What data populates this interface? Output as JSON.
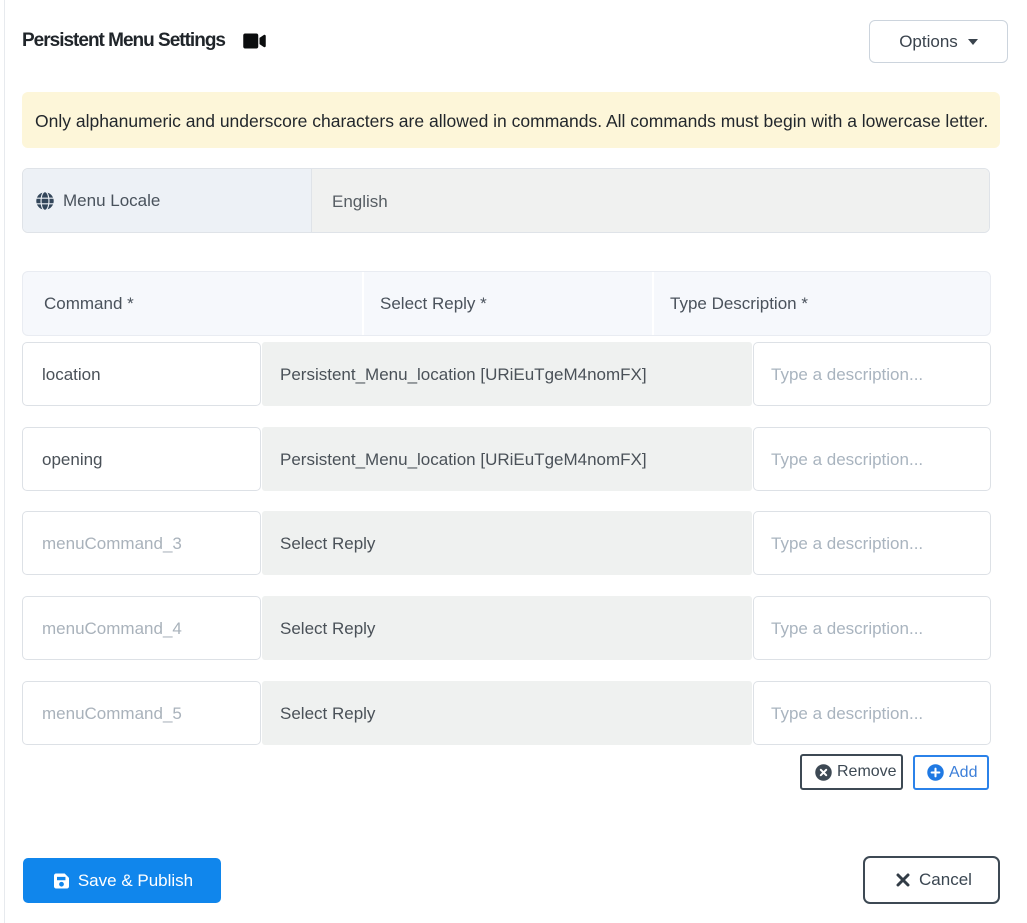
{
  "header": {
    "title": "Persistent Menu Settings",
    "options_label": "Options"
  },
  "alert": {
    "text": "Only alphanumeric and underscore characters are allowed in commands. All commands must begin with a lowercase letter."
  },
  "locale": {
    "label": "Menu Locale",
    "value": "English"
  },
  "table": {
    "headers": [
      "Command *",
      "Select Reply *",
      "Type Description *"
    ],
    "description_placeholder": "Type a description...",
    "rows": [
      {
        "command": "location",
        "reply": "Persistent_Menu_location [URiEuTgeM4nomFX]"
      },
      {
        "command": "opening",
        "reply": "Persistent_Menu_location [URiEuTgeM4nomFX]"
      },
      {
        "command": "menuCommand_3",
        "reply": "Select Reply"
      },
      {
        "command": "menuCommand_4",
        "reply": "Select Reply"
      },
      {
        "command": "menuCommand_5",
        "reply": "Select Reply"
      }
    ]
  },
  "actions": {
    "remove_label": "Remove",
    "add_label": "Add"
  },
  "footer": {
    "save_label": "Save & Publish",
    "cancel_label": "Cancel"
  },
  "colors": {
    "primary_blue": "#1086ec",
    "add_blue": "#1f79e3",
    "dark_slate": "#3d4954",
    "alert_bg": "#fdf6d9",
    "readonly_bg": "#f0f1f0",
    "header_bg": "#f6f8fc"
  }
}
